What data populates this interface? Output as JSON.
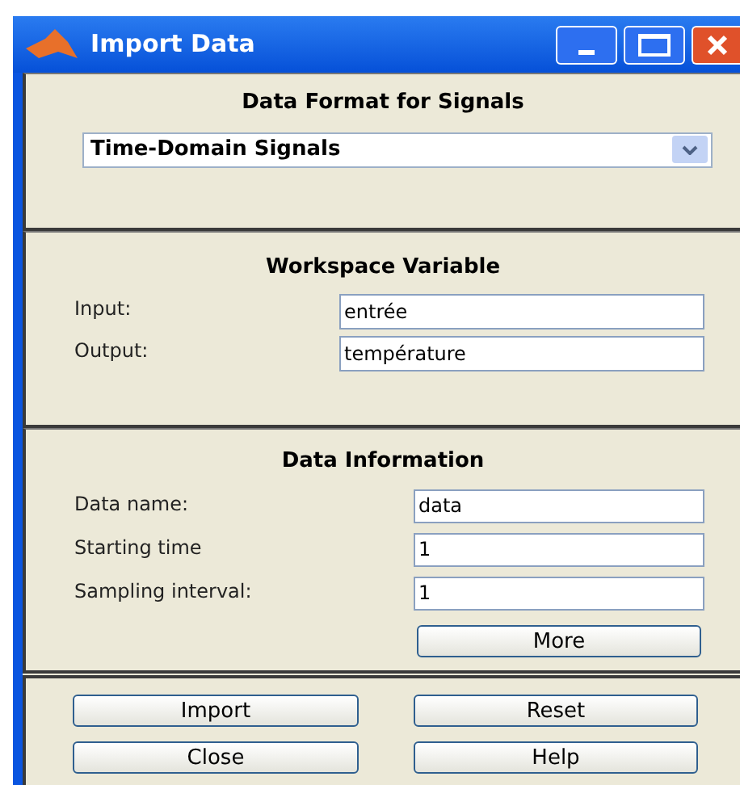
{
  "window": {
    "title": "Import Data"
  },
  "data_format": {
    "title": "Data Format for Signals",
    "dropdown": {
      "value": "Time-Domain Signals"
    }
  },
  "workspace_variable": {
    "title": "Workspace Variable",
    "fields": [
      {
        "label": "Input:",
        "value": "entrée"
      },
      {
        "label": "Output:",
        "value": "température"
      }
    ]
  },
  "data_information": {
    "title": "Data Information",
    "fields": [
      {
        "label": "Data name:",
        "value": "data"
      },
      {
        "label": "Starting time",
        "value": "1"
      },
      {
        "label": "Sampling interval:",
        "value": "1"
      }
    ],
    "more_button": "More"
  },
  "buttons": [
    "Import",
    "Reset",
    "Close",
    "Help"
  ]
}
